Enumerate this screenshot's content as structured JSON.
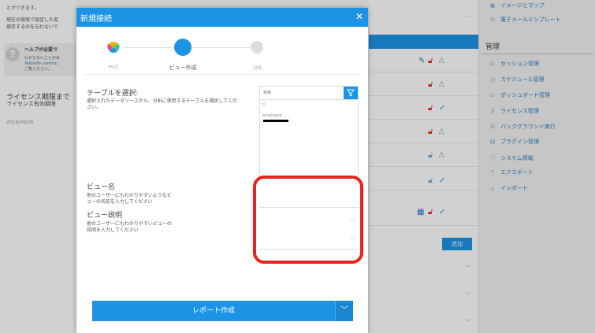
{
  "background": {
    "left_pane": {
      "line1": "とができます。",
      "line2": "現在の環境で設定した変",
      "line3": "保存するのを忘れないで",
      "help_title": "ヘルプが必要で",
      "help_body": [
        "わからないことがあ",
        "Yellowfin commu",
        "ご覧ください。"
      ],
      "license_title": "ライセンス期限まで",
      "license_sub": "ライセンス有効期限",
      "date": "2018/09/26"
    },
    "mid_pane": {
      "add_button": "追加"
    },
    "right_pane": {
      "top_items": [
        {
          "icon": "image-map-icon",
          "label": "イメージとマップ"
        },
        {
          "icon": "mail-template-icon",
          "label": "電子メールテンプレート"
        }
      ],
      "management_header": "管理",
      "management_items": [
        {
          "icon": "session-icon",
          "label": "セッション管理"
        },
        {
          "icon": "schedule-icon",
          "label": "スケジュール管理"
        },
        {
          "icon": "dashboard-icon",
          "label": "ダッシュボード管理"
        },
        {
          "icon": "license-icon",
          "label": "ライセンス管理"
        },
        {
          "icon": "background-icon",
          "label": "バックグラウンド実行"
        },
        {
          "icon": "plugin-icon",
          "label": "プラグイン管理"
        },
        {
          "icon": "system-info-icon",
          "label": "システム情報"
        },
        {
          "icon": "export-icon",
          "label": "エクスポート"
        },
        {
          "icon": "import-icon",
          "label": "インポート"
        }
      ]
    }
  },
  "modal": {
    "title": "新規接続",
    "steps": [
      {
        "label": "es2"
      },
      {
        "label": "ビュー作成"
      },
      {
        "label": "分析"
      }
    ],
    "table_select": {
      "label": "テーブルを選択:",
      "description": "選択されたデータソースから、分析に使用するテーブルを選択してください。",
      "search_placeholder": "検索",
      "list_x": "×",
      "list_item": "employee"
    },
    "view_name": {
      "label": "ビュー名",
      "description": "他のユーザーにもわかりやすいようなビューの名前を入力してください",
      "value": ""
    },
    "view_description": {
      "label": "ビュー説明",
      "description": "他のユーザーにもわかりやすいビューの説明を入力してください",
      "value": ""
    },
    "create_report_label": "レポート作成"
  },
  "colors": {
    "accent": "#1d93e6",
    "highlight": "#e5241d"
  }
}
